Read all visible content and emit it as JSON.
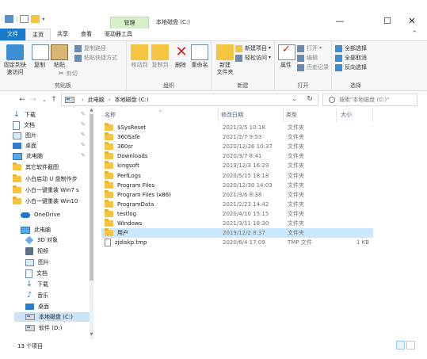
{
  "titlebar": {
    "context_tab": "管理",
    "title": "本地磁盘 (C:)",
    "minimize": "—",
    "maximize": "☐",
    "close": "✕"
  },
  "tabs": [
    "文件",
    "主页",
    "共享",
    "查看",
    "驱动器工具"
  ],
  "ribbon": {
    "pin_quick_access": [
      "固定到快",
      "速访问"
    ],
    "copy": "复制",
    "paste": "粘贴",
    "copy_path": "复制路径",
    "paste_shortcut": "粘贴快捷方式",
    "cut": "剪切",
    "clipboard_label": "剪贴板",
    "move_to": "移动到",
    "copy_to": "复制到",
    "delete": "删除",
    "rename": "重命名",
    "organize_label": "组织",
    "new_item": "新建项目",
    "easy_access": "轻松访问",
    "new_folder": [
      "新建",
      "文件夹"
    ],
    "new_label": "新建",
    "properties": "属性",
    "open": "打开",
    "edit": "编辑",
    "history": "历史记录",
    "open_label": "打开",
    "select_all": "全部选择",
    "select_none": "全部取消",
    "invert_selection": "反向选择",
    "select_label": "选择"
  },
  "address": {
    "back": "←",
    "forward": "→",
    "recent": "⌄",
    "up": "↑",
    "crumbs": [
      "此电脑",
      "本地磁盘 (C:)"
    ],
    "search_placeholder": "搜索\"本地磁盘 (C:)\""
  },
  "navpane": {
    "items": [
      {
        "label": "下载",
        "icon": "download-icon",
        "pinned": true
      },
      {
        "label": "文档",
        "icon": "document-icon",
        "pinned": true
      },
      {
        "label": "图片",
        "icon": "picture-icon",
        "pinned": true
      },
      {
        "label": "桌面",
        "icon": "desktop-icon",
        "pinned": true
      },
      {
        "label": "此电脑",
        "icon": "pc-icon",
        "pinned": true
      },
      {
        "label": "其它软件截图",
        "icon": "folder-icon"
      },
      {
        "label": "小白启动 U 盘制作步",
        "icon": "folder-icon"
      },
      {
        "label": "小白一键重装 Win7 s",
        "icon": "folder-icon"
      },
      {
        "label": "小白一键重装 Win10",
        "icon": "folder-icon"
      },
      {
        "label": "OneDrive",
        "icon": "onedrive-icon"
      },
      {
        "label": "此电脑",
        "icon": "pc-icon"
      },
      {
        "label": "3D 对象",
        "icon": "3d-objects-icon"
      },
      {
        "label": "视频",
        "icon": "video-icon"
      },
      {
        "label": "图片",
        "icon": "picture-icon"
      },
      {
        "label": "文档",
        "icon": "document-icon"
      },
      {
        "label": "下载",
        "icon": "download-icon"
      },
      {
        "label": "音乐",
        "icon": "music-icon"
      },
      {
        "label": "桌面",
        "icon": "desktop-icon"
      },
      {
        "label": "本地磁盘 (C:)",
        "icon": "drive-icon",
        "selected": true
      },
      {
        "label": "软件 (D:)",
        "icon": "drive-icon"
      }
    ],
    "pin_glyph": "📌"
  },
  "columns": {
    "name": "名称",
    "date": "修改日期",
    "type": "类型",
    "size": "大小"
  },
  "files": [
    {
      "name": "$SysReset",
      "date": "2021/3/5 10:18",
      "type": "文件夹",
      "size": ""
    },
    {
      "name": "360Safe",
      "date": "2021/2/7 9:53",
      "type": "文件夹",
      "size": ""
    },
    {
      "name": "360sr",
      "date": "2020/12/26 10:37",
      "type": "文件夹",
      "size": ""
    },
    {
      "name": "Downloads",
      "date": "2020/3/7 8:41",
      "type": "文件夹",
      "size": ""
    },
    {
      "name": "kingsoft",
      "date": "2019/12/3 16:29",
      "type": "文件夹",
      "size": ""
    },
    {
      "name": "PerfLogs",
      "date": "2020/5/15 18:18",
      "type": "文件夹",
      "size": ""
    },
    {
      "name": "Program Files",
      "date": "2020/12/30 14:03",
      "type": "文件夹",
      "size": ""
    },
    {
      "name": "Program Files (x86)",
      "date": "2021/3/6 8:38",
      "type": "文件夹",
      "size": ""
    },
    {
      "name": "ProgramData",
      "date": "2021/2/23 14:42",
      "type": "文件夹",
      "size": ""
    },
    {
      "name": "testlog",
      "date": "2020/4/10 15:15",
      "type": "文件夹",
      "size": ""
    },
    {
      "name": "Windows",
      "date": "2021/3/11 18:30",
      "type": "文件夹",
      "size": ""
    },
    {
      "name": "用户",
      "date": "2019/12/2 8:37",
      "type": "文件夹",
      "size": "",
      "highlighted": true
    },
    {
      "name": "zjdiskp.tmp",
      "date": "2020/6/4 17:09",
      "type": "TMP 文件",
      "size": "1 KB",
      "is_file": true
    }
  ],
  "status": {
    "item_count": "13 个项目"
  }
}
